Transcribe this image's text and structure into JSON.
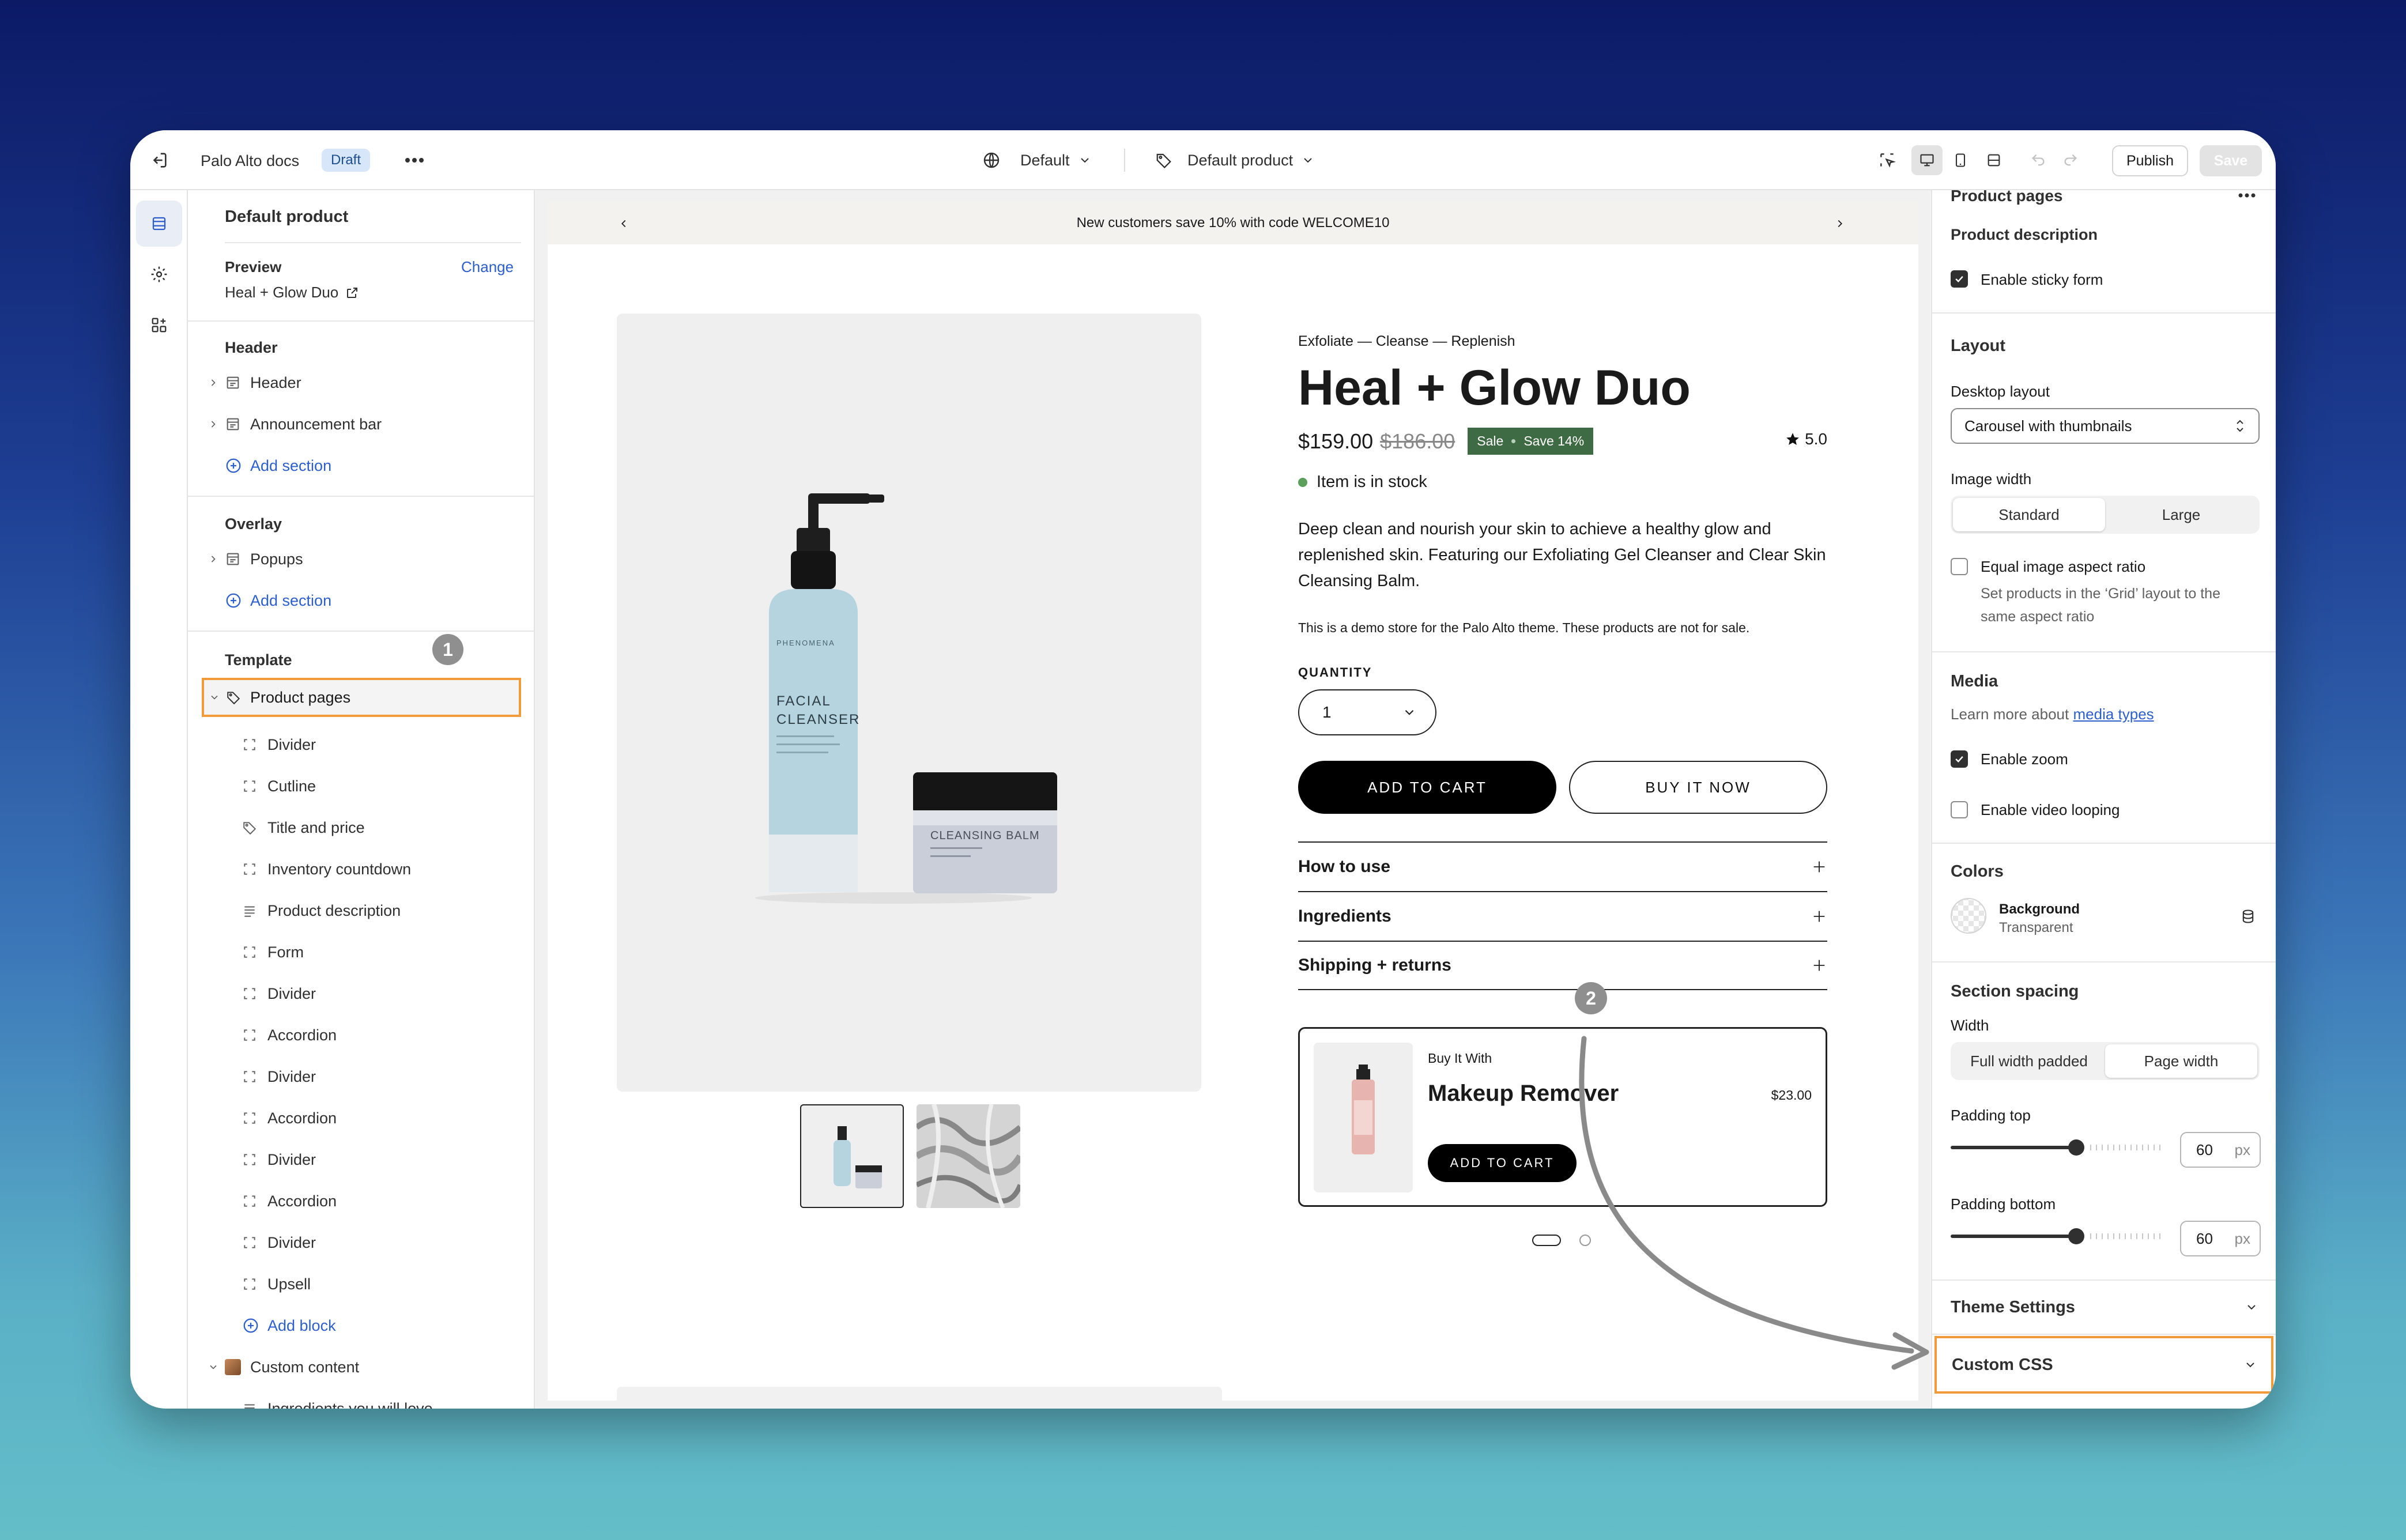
{
  "topbar": {
    "exit_label": "Exit",
    "store_name": "Palo Alto docs",
    "draft_badge": "Draft",
    "theme_select": "Default",
    "template_select": "Default product",
    "publish_label": "Publish",
    "save_label": "Save"
  },
  "left": {
    "title": "Default product",
    "preview_label": "Preview",
    "change_label": "Change",
    "preview_value": "Heal + Glow Duo",
    "header_group": "Header",
    "header_items": [
      "Header",
      "Announcement bar"
    ],
    "add_section": "Add section",
    "overlay_group": "Overlay",
    "overlay_items": [
      "Popups"
    ],
    "template_group": "Template",
    "product_pages": "Product pages",
    "blocks": [
      "Divider",
      "Cutline",
      "Title and price",
      "Inventory countdown",
      "Product description",
      "Form",
      "Divider",
      "Accordion",
      "Divider",
      "Accordion",
      "Divider",
      "Accordion",
      "Divider",
      "Upsell"
    ],
    "add_block": "Add block",
    "custom_content": "Custom content",
    "custom_child": "Ingredients you will love",
    "badge1": "1"
  },
  "preview": {
    "announcement": "New customers save 10% with code WELCOME10",
    "eyebrow": "Exfoliate — Cleanse — Replenish",
    "title": "Heal + Glow Duo",
    "price": "$159.00",
    "compare_price": "$186.00",
    "sale_badge": "Sale",
    "save_badge": "Save 14%",
    "rating": "5.0",
    "stock": "Item is in stock",
    "description": "Deep clean and nourish your skin to achieve a healthy glow and replenished skin. Featuring our Exfoliating Gel Cleanser and Clear Skin Cleansing Balm.",
    "demo_note": "This is a demo store for the Palo Alto theme. These products are not for sale.",
    "quantity_label": "QUANTITY",
    "quantity_value": "1",
    "add_to_cart": "ADD TO CART",
    "buy_now": "BUY IT NOW",
    "accordions": [
      "How to use",
      "Ingredients",
      "Shipping + returns"
    ],
    "upsell_label": "Buy It With",
    "upsell_title": "Makeup Remover",
    "upsell_price": "$23.00",
    "upsell_button": "ADD TO CART",
    "bottle_brand": "PHENOMENA",
    "bottle_name_1": "FACIAL",
    "bottle_name_2": "CLEANSER",
    "jar_name": "CLEANSING BALM",
    "badge2": "2"
  },
  "right": {
    "section_title": "Product pages",
    "product_description": "Product description",
    "sticky_form": "Enable sticky form",
    "layout_title": "Layout",
    "desktop_layout_label": "Desktop layout",
    "desktop_layout_value": "Carousel with thumbnails",
    "image_width_label": "Image width",
    "image_width_options": [
      "Standard",
      "Large"
    ],
    "equal_ratio": "Equal image aspect ratio",
    "equal_ratio_help": [
      "Set products in the ‘Grid’ layout to the",
      "same aspect ratio"
    ],
    "media_title": "Media",
    "learn_more": "Learn more about",
    "media_types_link": "media types",
    "enable_zoom": "Enable zoom",
    "video_looping": "Enable video looping",
    "colors_title": "Colors",
    "background_label": "Background",
    "background_value": "Transparent",
    "spacing_title": "Section spacing",
    "width_label": "Width",
    "width_options": [
      "Full width padded",
      "Page width"
    ],
    "padding_top_label": "Padding top",
    "padding_top_value": "60",
    "padding_bottom_label": "Padding bottom",
    "padding_bottom_value": "60",
    "unit": "px",
    "theme_settings": "Theme Settings",
    "custom_css": "Custom CSS"
  },
  "colors": {
    "highlight": "#f09a3a",
    "link": "#2c5fcc",
    "sale_badge": "#3f6b44",
    "stock_dot": "#5aa05a"
  },
  "state": {
    "sticky_form_checked": true,
    "equal_ratio_checked": false,
    "zoom_checked": true,
    "video_looping_checked": false,
    "image_width_selected": "Standard",
    "width_selected": "Page width"
  }
}
